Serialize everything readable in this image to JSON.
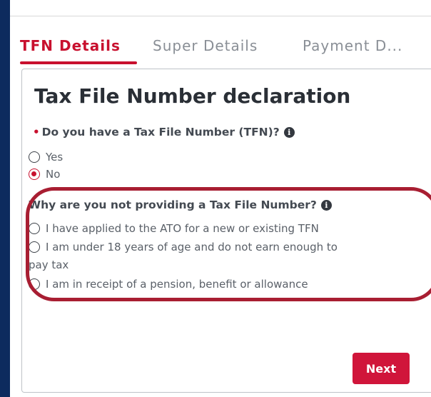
{
  "tabs": [
    {
      "label": "TFN Details",
      "active": true
    },
    {
      "label": "Super Details",
      "active": false
    },
    {
      "label": "Payment D...",
      "active": false
    }
  ],
  "form": {
    "title": "Tax File Number declaration",
    "question1": {
      "required_mark": "•",
      "label": "Do you have a Tax File Number (TFN)?",
      "info_icon": "info-icon",
      "options": [
        {
          "label": "Yes",
          "selected": false
        },
        {
          "label": "No",
          "selected": true
        }
      ]
    },
    "question2": {
      "label": "Why are you not providing a Tax File Number?",
      "info_icon": "info-icon",
      "options": [
        {
          "label": "I have applied to the ATO for a new or existing TFN",
          "selected": false
        },
        {
          "label": "I am under 18 years of age and do not earn enough to",
          "selected": false
        },
        {
          "label": "I am in receipt of a pension, benefit or allowance",
          "selected": false
        }
      ],
      "option2_continuation": "pay tax"
    },
    "next_label": "Next"
  },
  "colors": {
    "accent": "#c8102e",
    "highlight": "#a81e32",
    "frame": "#0d2b5e"
  }
}
